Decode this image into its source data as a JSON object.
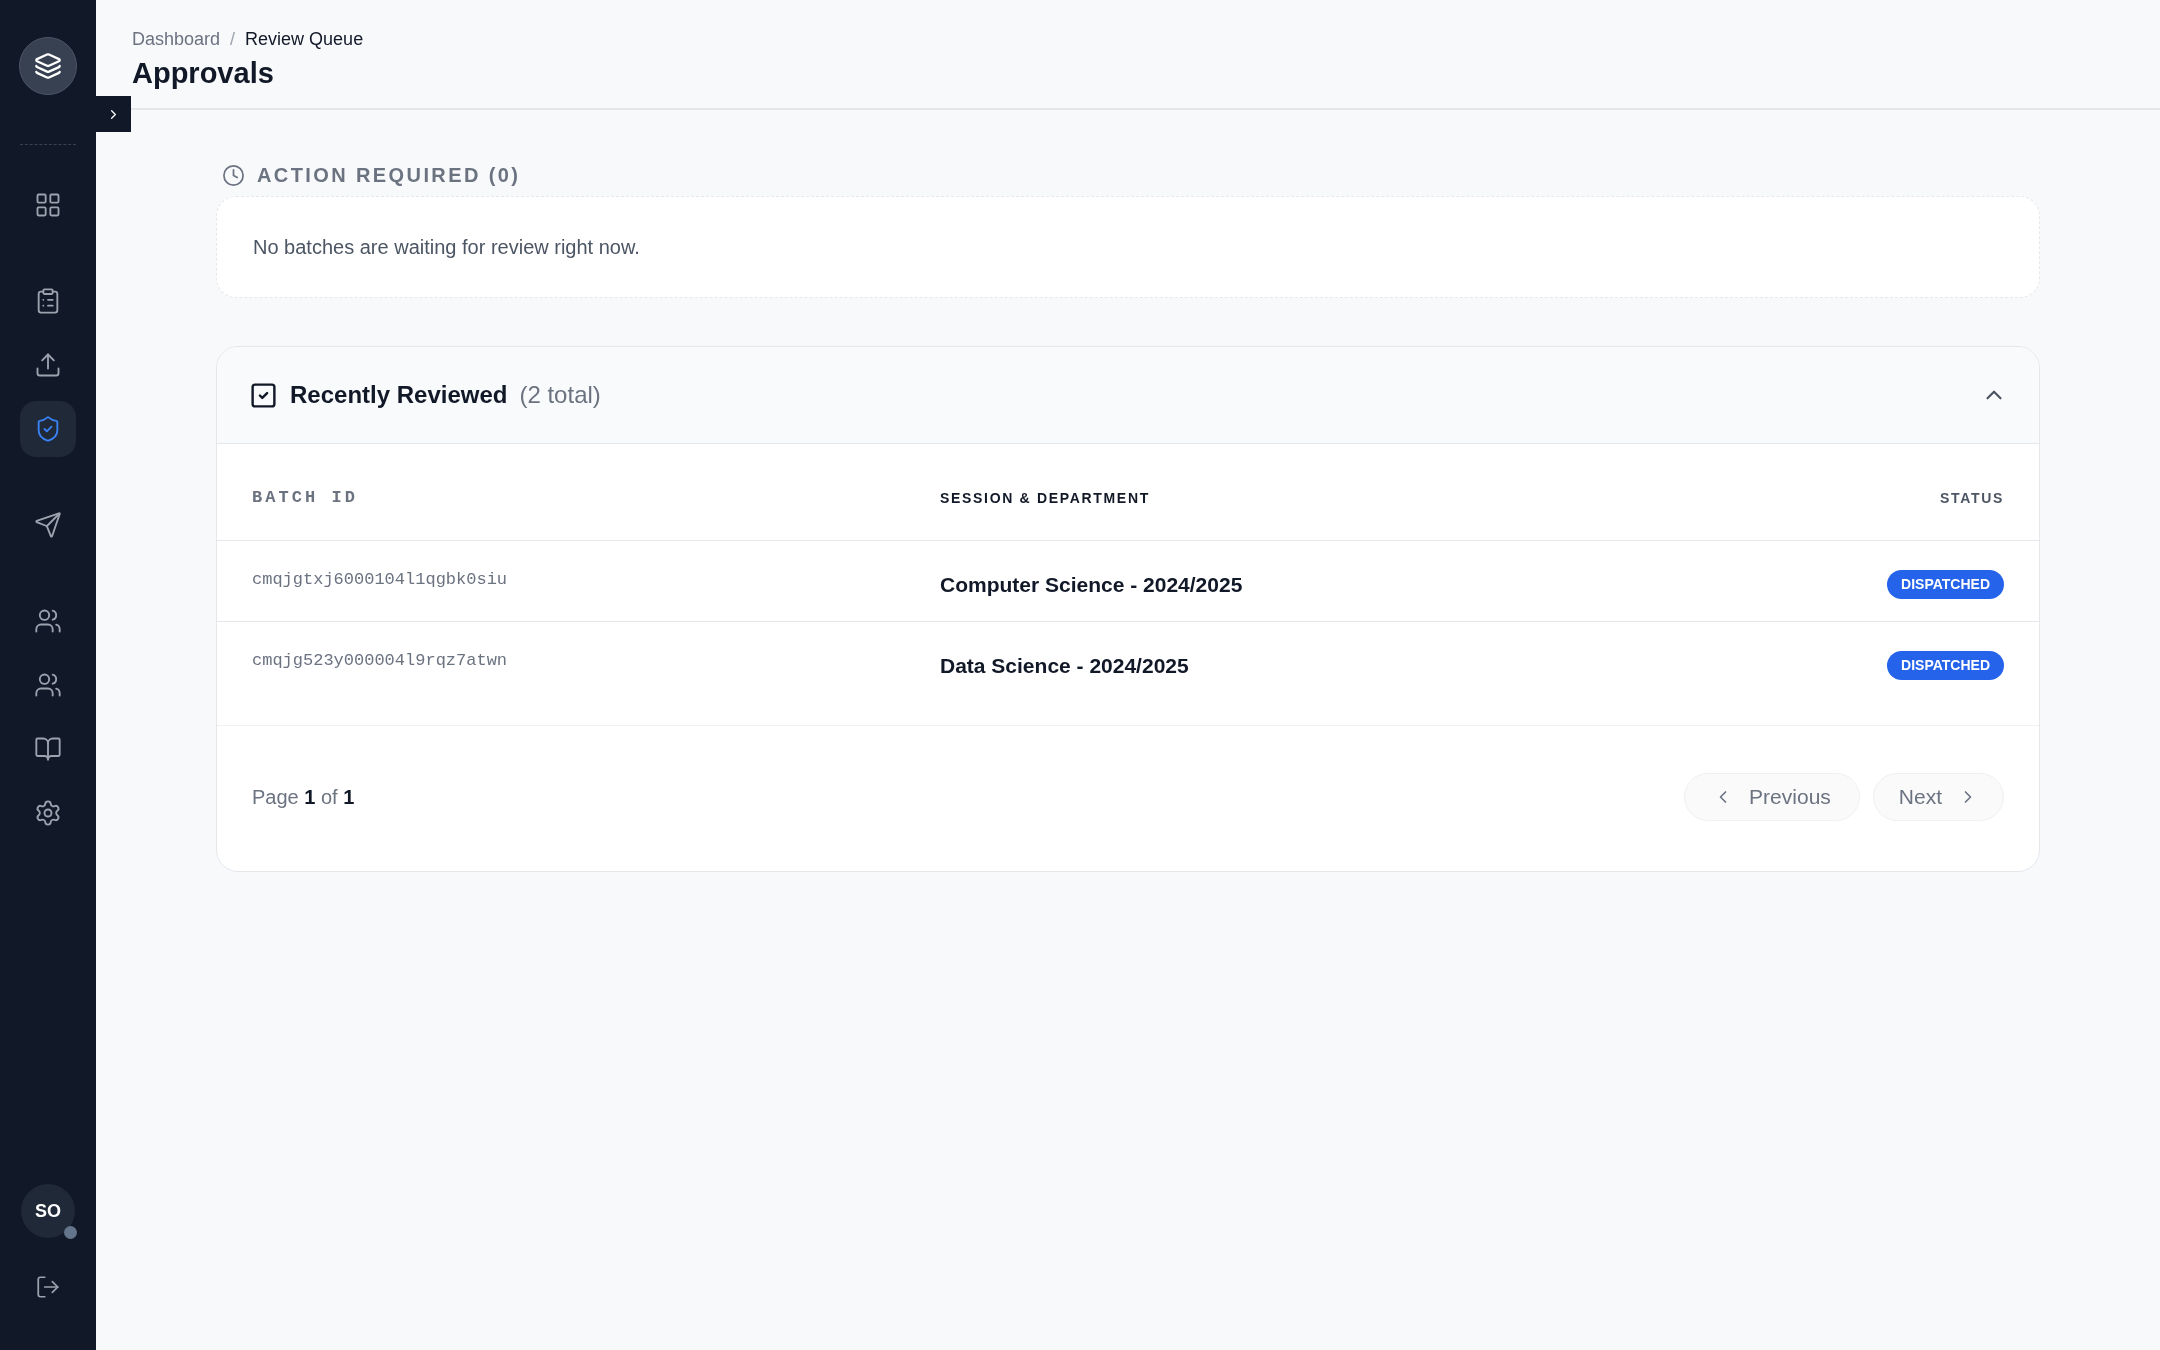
{
  "sidebar": {
    "items": [
      {
        "selected": false
      },
      {
        "selected": false
      },
      {
        "selected": false
      },
      {
        "selected": true
      },
      {
        "selected": false
      },
      {
        "selected": false
      },
      {
        "selected": false
      },
      {
        "selected": false
      },
      {
        "selected": false
      }
    ],
    "avatar": {
      "initials": "SO",
      "online": false
    }
  },
  "header": {
    "breadcrumb": [
      "Dashboard",
      "Review Queue"
    ],
    "breadcrumb_separator": "/",
    "title": "Approvals"
  },
  "action_required": {
    "heading": "ACTION REQUIRED (0)",
    "message": "No batches are waiting for review right now."
  },
  "recently_reviewed": {
    "title": "Recently Reviewed",
    "count": "(2 total)",
    "expanded": true,
    "columns": [
      "BATCH ID",
      "SESSION & DEPARTMENT",
      "STATUS"
    ],
    "rows": [
      {
        "batch_id": "cmqjgtxj6000104l1qgbk0siu",
        "session": "Computer Science - 2024/2025",
        "status": "DISPATCHED"
      },
      {
        "batch_id": "cmqjg523y000004l9rqz7atwn",
        "session": "Data Science - 2024/2025",
        "status": "DISPATCHED"
      }
    ],
    "pagination": {
      "page_label": "Page",
      "page": "1",
      "of_label": "of",
      "total": "1",
      "previous": {
        "label": "Previous",
        "disabled": true
      },
      "next": {
        "label": "Next",
        "disabled": true
      }
    }
  }
}
